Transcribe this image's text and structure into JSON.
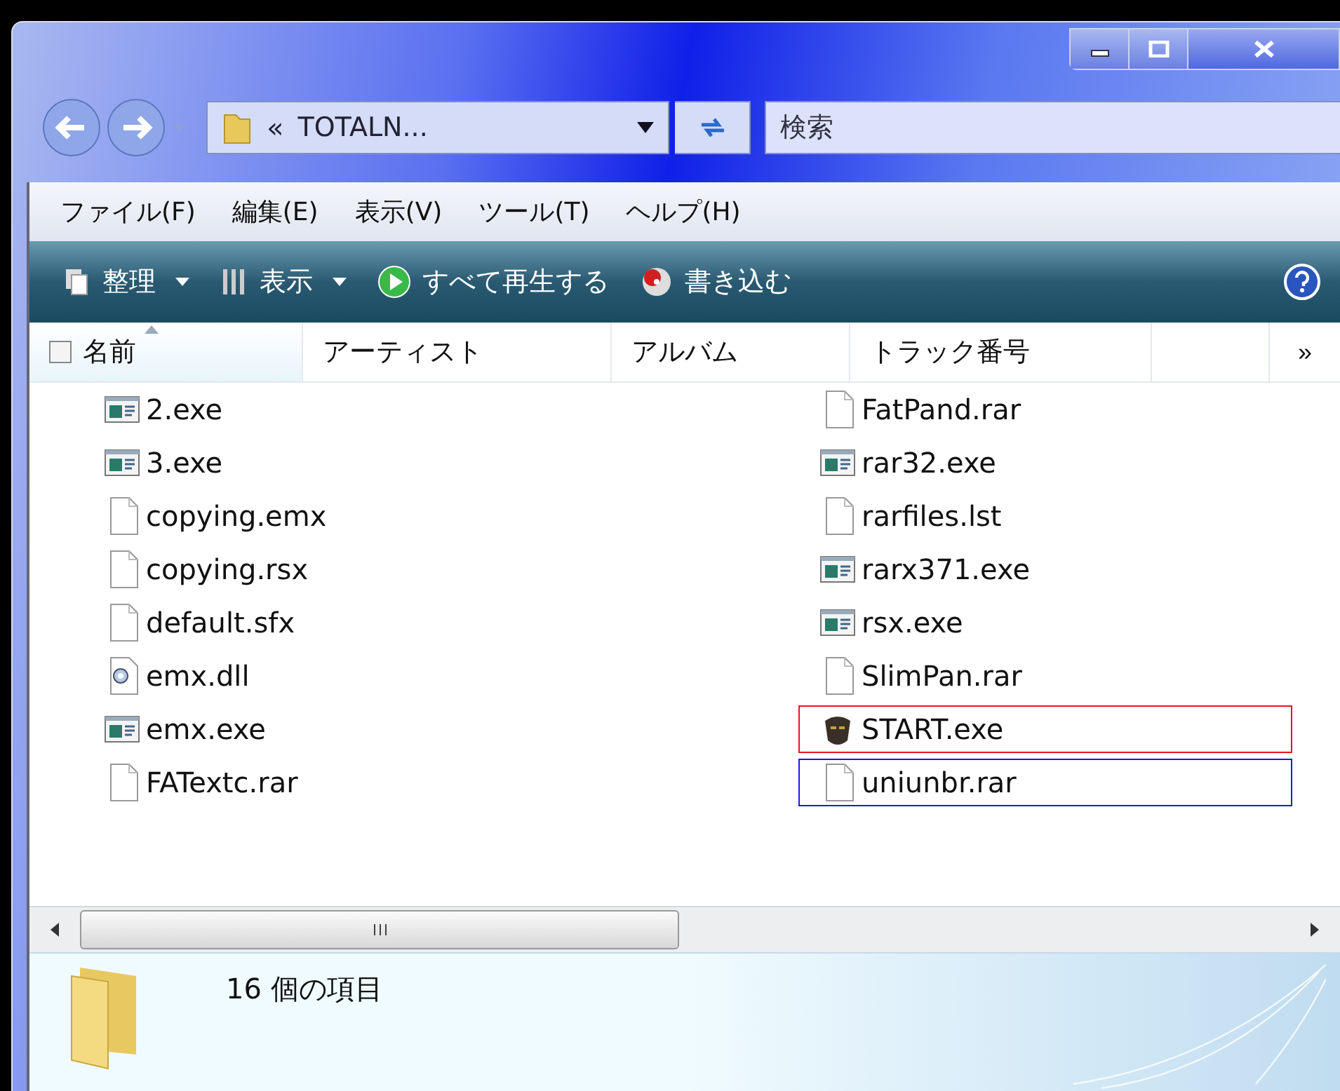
{
  "address": {
    "overflow": "«",
    "text": "TOTALN..."
  },
  "search": {
    "placeholder": "検索"
  },
  "menu": [
    "ファイル(F)",
    "編集(E)",
    "表示(V)",
    "ツール(T)",
    "ヘルプ(H)"
  ],
  "toolbar": [
    {
      "kind": "organize",
      "label": "整理"
    },
    {
      "kind": "views",
      "label": "表示"
    },
    {
      "kind": "play",
      "label": "すべて再生する"
    },
    {
      "kind": "burn",
      "label": "書き込む"
    }
  ],
  "columns": [
    {
      "label": "名前",
      "sorted": true
    },
    {
      "label": "アーティスト",
      "sorted": false
    },
    {
      "label": "アルバム",
      "sorted": false
    },
    {
      "label": "トラック番号",
      "sorted": false
    }
  ],
  "more_columns": "»",
  "files": [
    {
      "name": "2.exe",
      "kind": "exe"
    },
    {
      "name": "3.exe",
      "kind": "exe"
    },
    {
      "name": "copying.emx",
      "kind": "file"
    },
    {
      "name": "copying.rsx",
      "kind": "file"
    },
    {
      "name": "default.sfx",
      "kind": "file"
    },
    {
      "name": "emx.dll",
      "kind": "dll"
    },
    {
      "name": "emx.exe",
      "kind": "exe"
    },
    {
      "name": "FATextc.rar",
      "kind": "file"
    },
    {
      "name": "FatPand.rar",
      "kind": "file"
    },
    {
      "name": "rar32.exe",
      "kind": "exe"
    },
    {
      "name": "rarfiles.lst",
      "kind": "file"
    },
    {
      "name": "rarx371.exe",
      "kind": "exe"
    },
    {
      "name": "rsx.exe",
      "kind": "exe"
    },
    {
      "name": "SlimPan.rar",
      "kind": "file"
    },
    {
      "name": "START.exe",
      "kind": "app",
      "color": "#e8141e"
    },
    {
      "name": "uniunbr.rar",
      "kind": "file",
      "color": "#1a1ae0"
    }
  ],
  "status": {
    "text": "16 個の項目"
  }
}
